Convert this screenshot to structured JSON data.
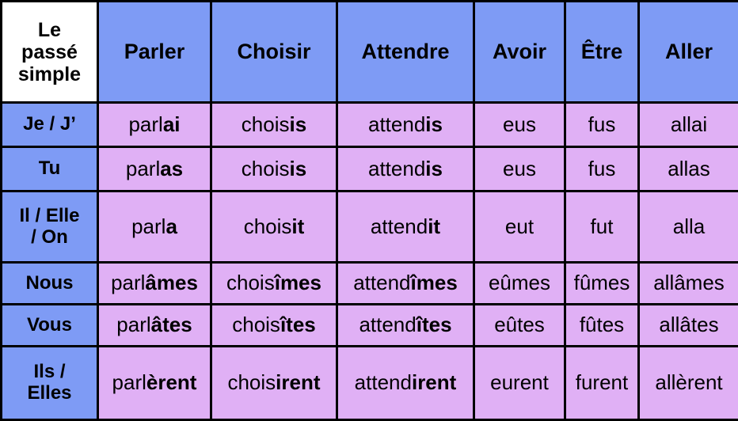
{
  "table": {
    "corner_label": "Le passé simple",
    "corner_label_lines": [
      "Le",
      "passé",
      "simple"
    ],
    "verb_headers": [
      {
        "label": "Parler"
      },
      {
        "label": "Choisir"
      },
      {
        "label": "Attendre"
      },
      {
        "label": "Avoir"
      },
      {
        "label": "Être"
      },
      {
        "label": "Aller"
      }
    ],
    "rows": [
      {
        "pronoun": "Je / J’",
        "pronoun_lines": [
          "Je / J’"
        ],
        "forms": [
          {
            "stem": "parl",
            "ending": "ai",
            "full": "parlai"
          },
          {
            "stem": "chois",
            "ending": "is",
            "full": "choisis"
          },
          {
            "stem": "attend",
            "ending": "is",
            "full": "attendis"
          },
          {
            "stem": "eus",
            "ending": "",
            "full": "eus"
          },
          {
            "stem": "fus",
            "ending": "",
            "full": "fus"
          },
          {
            "stem": "allai",
            "ending": "",
            "full": "allai"
          }
        ]
      },
      {
        "pronoun": "Tu",
        "pronoun_lines": [
          "Tu"
        ],
        "forms": [
          {
            "stem": "parl",
            "ending": "as",
            "full": "parlas"
          },
          {
            "stem": "chois",
            "ending": "is",
            "full": "choisis"
          },
          {
            "stem": "attend",
            "ending": "is",
            "full": "attendis"
          },
          {
            "stem": "eus",
            "ending": "",
            "full": "eus"
          },
          {
            "stem": "fus",
            "ending": "",
            "full": "fus"
          },
          {
            "stem": "allas",
            "ending": "",
            "full": "allas"
          }
        ]
      },
      {
        "pronoun": "Il / Elle / On",
        "pronoun_lines": [
          "Il / Elle",
          "/ On"
        ],
        "forms": [
          {
            "stem": "parl",
            "ending": "a",
            "full": "parla"
          },
          {
            "stem": "chois",
            "ending": "it",
            "full": "choisit"
          },
          {
            "stem": "attend",
            "ending": "it",
            "full": "attendit"
          },
          {
            "stem": "eut",
            "ending": "",
            "full": "eut"
          },
          {
            "stem": "fut",
            "ending": "",
            "full": "fut"
          },
          {
            "stem": "alla",
            "ending": "",
            "full": "alla"
          }
        ]
      },
      {
        "pronoun": "Nous",
        "pronoun_lines": [
          "Nous"
        ],
        "forms": [
          {
            "stem": "parl",
            "ending": "âmes",
            "full": "parlâmes"
          },
          {
            "stem": "chois",
            "ending": "îmes",
            "full": "choisîmes"
          },
          {
            "stem": "attend",
            "ending": "îmes",
            "full": "attendîmes"
          },
          {
            "stem": "eûmes",
            "ending": "",
            "full": "eûmes"
          },
          {
            "stem": "fûmes",
            "ending": "",
            "full": "fûmes"
          },
          {
            "stem": "allâmes",
            "ending": "",
            "full": "allâmes"
          }
        ]
      },
      {
        "pronoun": "Vous",
        "pronoun_lines": [
          "Vous"
        ],
        "forms": [
          {
            "stem": "parl",
            "ending": "âtes",
            "full": "parlâtes"
          },
          {
            "stem": "chois",
            "ending": "îtes",
            "full": "choisîtes"
          },
          {
            "stem": "attend",
            "ending": "îtes",
            "full": "attendîtes"
          },
          {
            "stem": "eûtes",
            "ending": "",
            "full": "eûtes"
          },
          {
            "stem": "fûtes",
            "ending": "",
            "full": "fûtes"
          },
          {
            "stem": "allâtes",
            "ending": "",
            "full": "allâtes"
          }
        ]
      },
      {
        "pronoun": "Ils / Elles",
        "pronoun_lines": [
          "Ils /",
          "Elles"
        ],
        "forms": [
          {
            "stem": "parl",
            "ending": "èrent",
            "full": "parlèrent"
          },
          {
            "stem": "chois",
            "ending": "irent",
            "full": "choisirent"
          },
          {
            "stem": "attend",
            "ending": "irent",
            "full": "attendirent"
          },
          {
            "stem": "eurent",
            "ending": "",
            "full": "eurent"
          },
          {
            "stem": "furent",
            "ending": "",
            "full": "furent"
          },
          {
            "stem": "allèrent",
            "ending": "",
            "full": "allèrent"
          }
        ]
      }
    ]
  },
  "colors": {
    "header_blue": "#7E9BF5",
    "cell_violet": "#E0B0F5",
    "corner_white": "#FFFFFF",
    "border_black": "#000000",
    "text_black": "#000000"
  }
}
